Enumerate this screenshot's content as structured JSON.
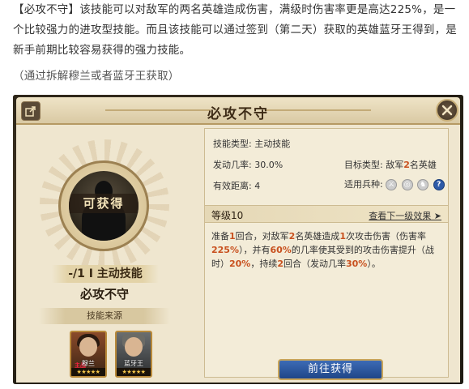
{
  "article": {
    "para1": "【必攻不守】该技能可以对敌军的两名英雄造成伤害，满级时伤害率更是高达225%，是一个比较强力的进攻型技能。而且该技能可以通过签到（第二天）获取的英雄蓝牙王得到，是新手前期比较容易获得的强力技能。",
    "note": "（通过拆解穆兰或者蓝牙王获取）"
  },
  "dialog": {
    "title": "必攻不守",
    "share_icon": "share-icon",
    "close_icon": "close-icon"
  },
  "left": {
    "availability": "可获得",
    "skill_type_banner": "-/1 I 主动技能",
    "skill_name": "必攻不守",
    "source_label": "技能来源",
    "heroes": [
      {
        "name": "穆兰",
        "tag": "主战",
        "stars": "★★★★★"
      },
      {
        "name": "蓝牙王",
        "stars": "★★★★★"
      }
    ]
  },
  "right": {
    "skill_type_key": "技能类型:",
    "skill_type_val": "主动技能",
    "chance_key": "发动几率:",
    "chance_val": "30.0%",
    "range_key": "有效距离:",
    "range_val": "4",
    "target_key": "目标类型:",
    "target_prefix": "敌军",
    "target_num": "2",
    "target_suffix": "名英雄",
    "troops_key": "适用兵种:",
    "troop_icons": [
      "sword-icon",
      "shield-icon",
      "horse-icon",
      "question-icon"
    ],
    "level": "等级10",
    "next_level_link": "查看下一级效果 ➤",
    "desc": {
      "p1": "准备",
      "n1": "1",
      "p2": "回合，对敌军",
      "n2": "2",
      "p3": "名英雄造成",
      "n3": "1",
      "p4": "次攻击伤害（伤害率",
      "n4": "225%",
      "p5": "），并有",
      "n5": "60%",
      "p6": "的几率使其受到的攻击伤害提升（战时）",
      "n6": "20%",
      "p7": "，持续",
      "n7": "2",
      "p8": "回合（发动几率",
      "n8": "30%",
      "p9": "）。"
    },
    "go_button": "前往获得"
  },
  "colors": {
    "highlight": "#c8501e",
    "button_blue": "#2d5aa8",
    "panel_bg": "#efe6cf"
  }
}
